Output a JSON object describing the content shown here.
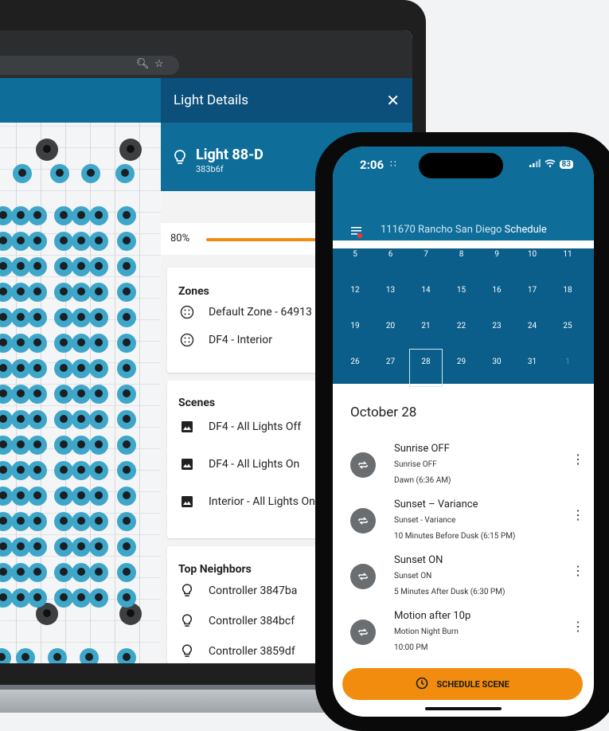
{
  "laptop": {
    "panel": {
      "title": "Light Details",
      "light_name": "Light 88-D",
      "light_id": "383b6f",
      "level_label": "80%",
      "level_fraction": 0.8,
      "zones": {
        "title": "Zones",
        "items": [
          "Default Zone - 64913",
          "DF4 - Interior"
        ]
      },
      "scenes": {
        "title": "Scenes",
        "items": [
          "DF4 - All Lights Off",
          "DF4 - All Lights On",
          "Interior - All Lights On"
        ]
      },
      "neighbors": {
        "title": "Top Neighbors",
        "items": [
          "Controller 3847ba",
          "Controller 384bcf",
          "Controller 3859df"
        ]
      }
    }
  },
  "phone": {
    "time": "2:06",
    "battery": "83",
    "header": {
      "site": "111670 Rancho San Diego",
      "section": "Schedule"
    },
    "calendar": {
      "rows": [
        [
          "5",
          "6",
          "7",
          "8",
          "9",
          "10",
          "11"
        ],
        [
          "12",
          "13",
          "14",
          "15",
          "16",
          "17",
          "18"
        ],
        [
          "19",
          "20",
          "21",
          "22",
          "23",
          "24",
          "25"
        ],
        [
          "26",
          "27",
          "28",
          "29",
          "30",
          "31",
          "1"
        ]
      ],
      "selected": "28"
    },
    "date_heading": "October 28",
    "events": [
      {
        "title": "Sunrise OFF",
        "subtitle": "Sunrise OFF",
        "time": "Dawn (6:36 AM)"
      },
      {
        "title": "Sunset – Variance",
        "subtitle": "Sunset - Variance",
        "time": "10 Minutes Before Dusk (6:15 PM)"
      },
      {
        "title": "Sunset ON",
        "subtitle": "Sunset ON",
        "time": "5 Minutes After Dusk (6:30 PM)"
      },
      {
        "title": "Motion after 10p",
        "subtitle": "Motion Night Burn",
        "time": "10:00 PM"
      }
    ],
    "schedule_button": "SCHEDULE SCENE"
  },
  "colors": {
    "primary": "#0e6d99",
    "primary_dark": "#0b4f7a",
    "accent": "#f28c0f",
    "light_dot": "#3ea6c9"
  }
}
